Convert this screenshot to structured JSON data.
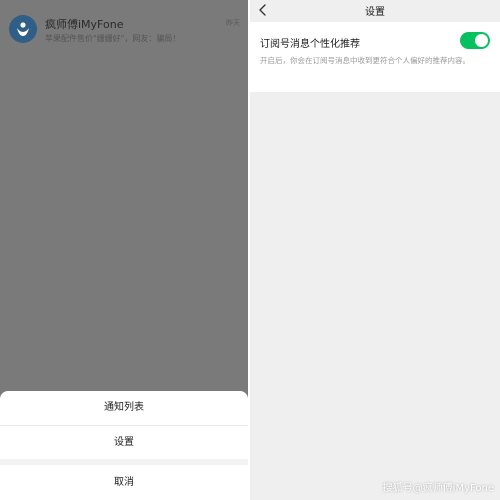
{
  "left_panel": {
    "chat": {
      "name": "疯师傅iMyFone",
      "preview": "苹果配件售价\"姗姗好\"，网友：骗局！",
      "time": "昨天",
      "avatar_icon": "person-logo-icon"
    },
    "sheet": {
      "items": [
        {
          "label": "通知列表"
        },
        {
          "label": "设置"
        }
      ],
      "cancel_label": "取消"
    }
  },
  "right_panel": {
    "back_icon": "chevron-left-icon",
    "title": "设置",
    "setting": {
      "label": "订阅号消息个性化推荐",
      "description": "开启后，你会在订阅号消息中收到更符合个人偏好的推荐内容。",
      "enabled": true
    }
  },
  "watermark": "搜狐号@疯师傅iMyFone",
  "colors": {
    "toggle_on": "#07c160",
    "overlay": "#7a7a7a",
    "avatar": "#2f5f86"
  }
}
